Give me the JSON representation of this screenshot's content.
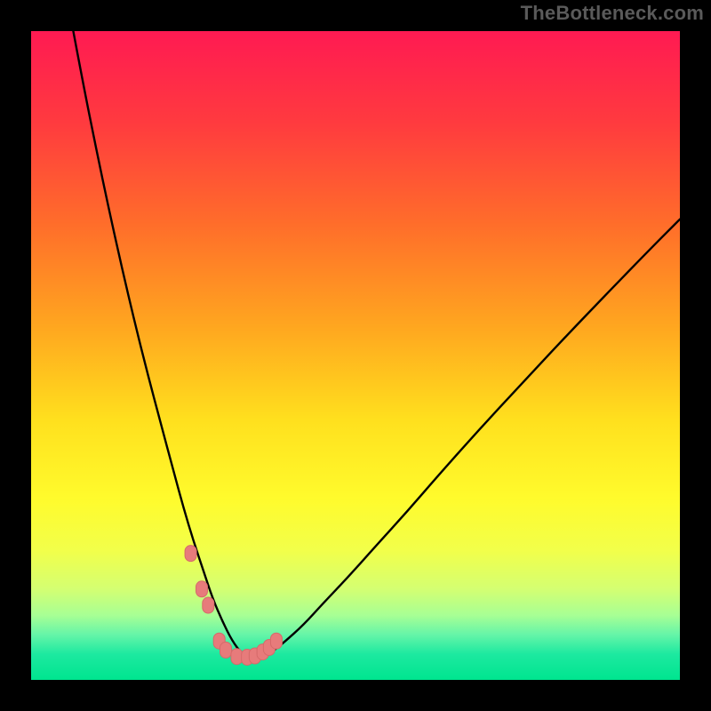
{
  "watermark": "TheBottleneck.com",
  "colors": {
    "frame": "#000000",
    "curve": "#000000",
    "marker_fill": "#e77b7b",
    "marker_stroke": "#d66a6a",
    "gradient_stops": [
      {
        "offset": "0%",
        "color": "#ff1a52"
      },
      {
        "offset": "14%",
        "color": "#ff3a3f"
      },
      {
        "offset": "30%",
        "color": "#ff6e2a"
      },
      {
        "offset": "46%",
        "color": "#ffa81f"
      },
      {
        "offset": "60%",
        "color": "#ffe01e"
      },
      {
        "offset": "72%",
        "color": "#fffb2c"
      },
      {
        "offset": "80%",
        "color": "#f2ff4a"
      },
      {
        "offset": "86%",
        "color": "#d4ff72"
      },
      {
        "offset": "90%",
        "color": "#a8ff94"
      },
      {
        "offset": "93%",
        "color": "#66f5a8"
      },
      {
        "offset": "96%",
        "color": "#1de9a0"
      },
      {
        "offset": "100%",
        "color": "#00e58f"
      }
    ]
  },
  "chart_data": {
    "type": "line",
    "title": "",
    "xlabel": "",
    "ylabel": "",
    "xlim": [
      0,
      100
    ],
    "ylim": [
      0,
      100
    ],
    "series": [
      {
        "name": "bottleneck-curve",
        "x": [
          6.5,
          8,
          10,
          12,
          14,
          16,
          18,
          20,
          22,
          23.5,
          25,
          26.5,
          28,
          29.5,
          31,
          32.5,
          33.5,
          35,
          37,
          39,
          42,
          45,
          49,
          53,
          58,
          63,
          69,
          75,
          82,
          89,
          96,
          100
        ],
        "values": [
          100,
          92,
          82,
          72.5,
          63.5,
          55,
          47,
          39.5,
          32,
          26.5,
          21.5,
          17,
          12.5,
          9,
          6,
          4,
          3.4,
          3.4,
          4.2,
          5.8,
          8.5,
          11.8,
          16,
          20.5,
          26,
          31.8,
          38.5,
          45,
          52.5,
          59.8,
          67,
          71
        ]
      }
    ],
    "markers": {
      "name": "highlighted-points",
      "x": [
        24.6,
        26.3,
        27.3,
        29.0,
        30.0,
        31.7,
        33.3,
        34.5,
        35.7,
        36.7,
        37.8
      ],
      "values": [
        19.5,
        14.0,
        11.5,
        6.0,
        4.6,
        3.6,
        3.5,
        3.7,
        4.3,
        5.0,
        6.0
      ]
    }
  }
}
